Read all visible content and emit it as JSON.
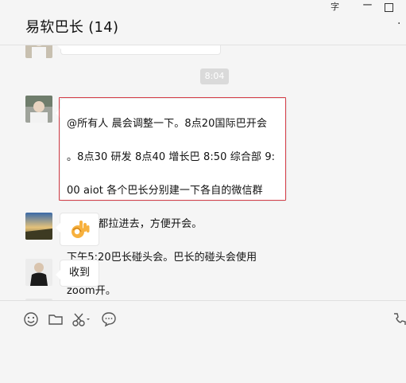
{
  "window": {
    "title": "易软巴长 (14)",
    "controls": {
      "minimize_glyph": "字",
      "dash": "ー",
      "more_glyph": "·"
    }
  },
  "chat": {
    "time_chip": "8:04",
    "messages": [
      {
        "sender_avatar": "avatar-person-white",
        "text_lines": [
          "@所有人 晨会调整一下。8点20国际巴开会",
          "。8点30 研发 8点40 增长巴 8:50 综合部 9:",
          "00 aiot 各个巴长分别建一下各自的微信群",
          "，把人都拉进去，方便开会。",
          "下午5:20巴长碰头会。巴长的碰头会使用",
          "zoom开。"
        ],
        "highlighted": true
      },
      {
        "sender_avatar": "avatar-landscape",
        "content": "ok-hand-emoji"
      },
      {
        "sender_avatar": "avatar-person-black",
        "text": "收到"
      }
    ]
  },
  "toolbar": {
    "icons": [
      "emoji-icon",
      "folder-icon",
      "scissors-icon",
      "chat-bubble-icon",
      "phone-icon"
    ]
  },
  "colors": {
    "highlight_border": "#d6404a",
    "background": "#f5f5f5"
  }
}
